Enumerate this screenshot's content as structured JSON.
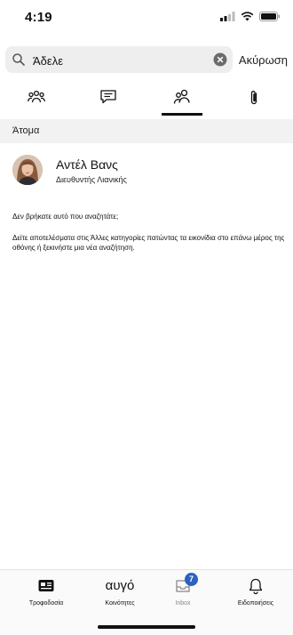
{
  "status_bar": {
    "time": "4:19"
  },
  "search": {
    "value": "Άδελε",
    "cancel_label": "Ακύρωση"
  },
  "tabs": [
    {
      "icon": "group-icon",
      "selected": false
    },
    {
      "icon": "chat-icon",
      "selected": false
    },
    {
      "icon": "people-icon",
      "selected": true
    },
    {
      "icon": "paperclip-icon",
      "selected": false
    }
  ],
  "section": {
    "title": "Άτομα"
  },
  "results": [
    {
      "name": "Αντέλ Βανς",
      "title": "Διευθυντής Λιανικής"
    }
  ],
  "not_found": {
    "question": "Δεν βρήκατε αυτό που αναζητάτε;",
    "detail": "Δείτε αποτελέσματα στις Άλλες κατηγορίες πατώντας τα εικονίδια στο επάνω μέρος της οθόνης ή ξεκινήστε μια νέα αναζήτηση."
  },
  "bottom_nav": [
    {
      "label": "Τροφοδοσία",
      "icon": "feed-icon"
    },
    {
      "label": "Κοινότητες",
      "display": "αυγό"
    },
    {
      "label": "Inbox",
      "icon": "inbox-icon",
      "badge": "7"
    },
    {
      "label": "Ειδοποιήσεις",
      "icon": "bell-icon"
    }
  ],
  "colors": {
    "badge": "#2c62c0",
    "search_bg": "#eeeeee",
    "section_bg": "#f2f2f2"
  }
}
